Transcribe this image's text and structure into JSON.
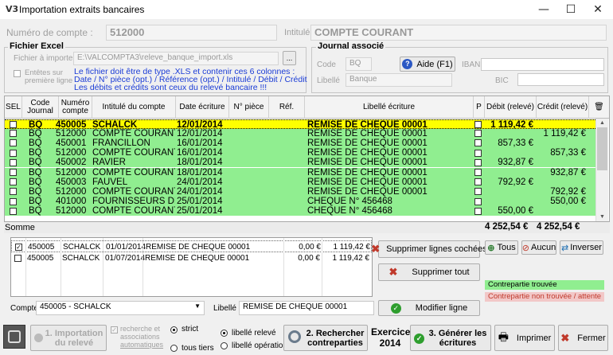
{
  "window": {
    "title": "Importation extraits bancaires",
    "app_icon": "V3",
    "minimize": "—",
    "maximize": "☐",
    "close": "✕"
  },
  "account": {
    "numero_label": "Numéro de compte :",
    "numero_value": "512000",
    "intitule_label": "Intitulé",
    "intitule_value": "COMPTE COURANT"
  },
  "excel": {
    "group_title": "Fichier Excel",
    "file_label": "Fichier à importer",
    "file_value": "E:\\VALCOMPTA3\\releve_banque_import.xls",
    "browse_label": "...",
    "headers_label_1": "Entêtes sur",
    "headers_label_2": "première ligne",
    "info_1": "Le fichier doit être de type .XLS et contenir ces 6 colonnes :",
    "info_2": "Date  /  N° pièce (opt.)  /  Référence (opt.)  /  Intitulé  /  Débit  /  Crédit",
    "info_3": "Les débits et crédits sont ceux du relevé bancaire !!!"
  },
  "journal": {
    "group_title": "Journal associé",
    "code_label": "Code",
    "code_value": "BQ",
    "libelle_label": "Libellé",
    "libelle_value": "Banque",
    "help_label": "Aide (F1)",
    "iban_label": "IBAN",
    "iban_value": "",
    "bic_label": "BIC",
    "bic_value": ""
  },
  "grid": {
    "headers": {
      "sel": "SEL",
      "code": "Code Journal",
      "numero": "Numéro compte",
      "intitule": "Intitulé du compte",
      "date": "Date écriture",
      "piece": "N° pièce",
      "ref": "Réf.",
      "libelle": "Libellé écriture",
      "p": "P",
      "debit": "Débit (relevé)",
      "credit": "Crédit (relevé)"
    },
    "rows": [
      {
        "code": "BQ",
        "num": "450005",
        "intitule": "SCHALCK",
        "date": "12/01/2014",
        "piece": "",
        "ref": "",
        "libelle": "REMISE DE CHEQUE 00001",
        "debit": "1 119,42 €",
        "credit": "",
        "selected": true
      },
      {
        "code": "BQ",
        "num": "512000",
        "intitule": "COMPTE COURANT",
        "date": "12/01/2014",
        "piece": "",
        "ref": "",
        "libelle": "REMISE DE CHEQUE 00001",
        "debit": "",
        "credit": "1 119,42 €",
        "selected": false
      },
      {
        "code": "BQ",
        "num": "450001",
        "intitule": "FRANCILLON",
        "date": "16/01/2014",
        "piece": "",
        "ref": "",
        "libelle": "REMISE DE CHEQUE 00001",
        "debit": "857,33 €",
        "credit": "",
        "selected": false
      },
      {
        "code": "BQ",
        "num": "512000",
        "intitule": "COMPTE COURANT",
        "date": "16/01/2014",
        "piece": "",
        "ref": "",
        "libelle": "REMISE DE CHEQUE 00001",
        "debit": "",
        "credit": "857,33 €",
        "selected": false
      },
      {
        "code": "BQ",
        "num": "450002",
        "intitule": "RAVIER",
        "date": "18/01/2014",
        "piece": "",
        "ref": "",
        "libelle": "REMISE DE CHEQUE 00001",
        "debit": "932,87 €",
        "credit": "",
        "selected": false
      },
      {
        "code": "BQ",
        "num": "512000",
        "intitule": "COMPTE COURANT",
        "date": "18/01/2014",
        "piece": "",
        "ref": "",
        "libelle": "REMISE DE CHEQUE 00001",
        "debit": "",
        "credit": "932,87 €",
        "selected": false
      },
      {
        "code": "BQ",
        "num": "450003",
        "intitule": "FAUVEL",
        "date": "24/01/2014",
        "piece": "",
        "ref": "",
        "libelle": "REMISE DE CHEQUE 00001",
        "debit": "792,92 €",
        "credit": "",
        "selected": false
      },
      {
        "code": "BQ",
        "num": "512000",
        "intitule": "COMPTE COURANT",
        "date": "24/01/2014",
        "piece": "",
        "ref": "",
        "libelle": "REMISE DE CHEQUE 00001",
        "debit": "",
        "credit": "792,92 €",
        "selected": false
      },
      {
        "code": "BQ",
        "num": "401000",
        "intitule": "FOURNISSEURS DIV",
        "date": "25/01/2014",
        "piece": "",
        "ref": "",
        "libelle": "CHEQUE N° 456468",
        "debit": "",
        "credit": "550,00 €",
        "selected": false
      },
      {
        "code": "BQ",
        "num": "512000",
        "intitule": "COMPTE COURANT",
        "date": "25/01/2014",
        "piece": "",
        "ref": "",
        "libelle": "CHEQUE N° 456468",
        "debit": "550,00 €",
        "credit": "",
        "selected": false
      }
    ],
    "sum_label": "Somme",
    "sum_debit": "4 252,54 €",
    "sum_credit": "4 252,54 €"
  },
  "lower_list": {
    "rows": [
      {
        "num": "450005",
        "name": "SCHALCK",
        "date": "01/01/2014",
        "libelle": "REMISE DE CHEQUE 00001",
        "debit": "0,00 €",
        "credit": "1 119,42 €",
        "checked": true
      },
      {
        "num": "450005",
        "name": "SCHALCK",
        "date": "01/07/2014",
        "libelle": "REMISE DE CHEQUE 00001",
        "debit": "0,00 €",
        "credit": "1 119,42 €",
        "checked": false
      }
    ]
  },
  "actions": {
    "delete_checked": "Supprimer lignes cochées",
    "delete_all": "Supprimer tout",
    "tous": "Tous",
    "aucun": "Aucun",
    "inverser": "Inverser",
    "modify_line": "Modifier ligne"
  },
  "legend": {
    "found": "Contrepartie trouvée",
    "not_found": "Contrepartie non trouvée / attente",
    "found_color": "#90ee90",
    "not_found_color": "#f2c8c8"
  },
  "edit": {
    "compte_label": "Compte",
    "compte_value": "450005 - SCHALCK",
    "libelle_label": "Libellé",
    "libelle_value": "REMISE DE CHEQUE 00001"
  },
  "footer": {
    "import_label_1": "1. Importation",
    "import_label_2": "du relevé",
    "auto_1": "recherche et",
    "auto_2": "associations",
    "auto_3": "automatiques",
    "strict": "strict",
    "tous_tiers": "tous tiers",
    "libelle_releve": "libellé relevé",
    "libelle_operation": "libellé opération",
    "search_1": "2. Rechercher",
    "search_2": "contreparties",
    "exercice_1": "Exercice",
    "exercice_2": "2014",
    "generate_1": "3. Générer les",
    "generate_2": "écritures",
    "print": "Imprimer",
    "close": "Fermer"
  }
}
